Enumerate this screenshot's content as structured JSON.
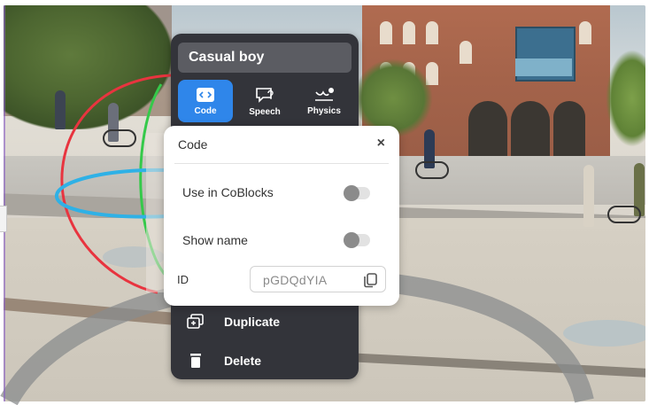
{
  "object_panel": {
    "name": "Casual boy",
    "tabs": [
      {
        "label": "Code",
        "icon": "code-icon",
        "active": true
      },
      {
        "label": "Speech",
        "icon": "speech-bubble-icon",
        "active": false
      },
      {
        "label": "Physics",
        "icon": "physics-icon",
        "active": false
      }
    ],
    "actions": [
      {
        "label": "Duplicate",
        "icon": "duplicate-icon"
      },
      {
        "label": "Delete",
        "icon": "trash-icon"
      }
    ]
  },
  "code_popup": {
    "title": "Code",
    "close_symbol": "×",
    "settings": [
      {
        "label": "Use in CoBlocks",
        "enabled": false
      },
      {
        "label": "Show name",
        "enabled": false
      }
    ],
    "id_label": "ID",
    "id_value": "pGDQdYIA"
  },
  "colors": {
    "panel_bg": "#33343a",
    "accent": "#2f86ea",
    "gizmo_x": "#e8343f",
    "gizmo_y": "#35c94a",
    "gizmo_z": "#2fb1e6"
  }
}
